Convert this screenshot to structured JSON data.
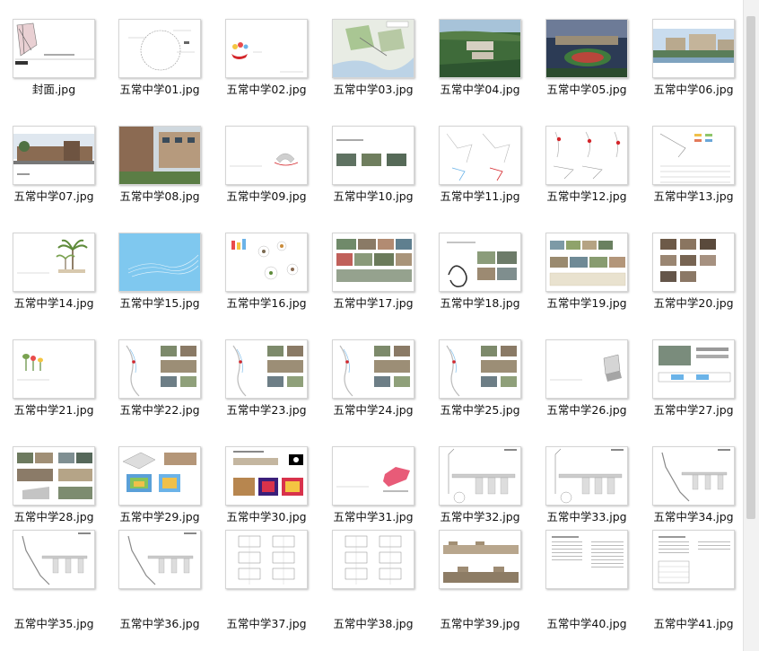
{
  "files": [
    {
      "name": "封面.jpg",
      "kind": "cover"
    },
    {
      "name": "五常中学01.jpg",
      "kind": "sketch-circle"
    },
    {
      "name": "五常中学02.jpg",
      "kind": "sketch-red"
    },
    {
      "name": "五常中学03.jpg",
      "kind": "map"
    },
    {
      "name": "五常中学04.jpg",
      "kind": "aerial-green"
    },
    {
      "name": "五常中学05.jpg",
      "kind": "aerial-dusk"
    },
    {
      "name": "五常中学06.jpg",
      "kind": "render-lake"
    },
    {
      "name": "五常中学07.jpg",
      "kind": "render-building"
    },
    {
      "name": "五常中学08.jpg",
      "kind": "render-street"
    },
    {
      "name": "五常中学09.jpg",
      "kind": "diagram-center"
    },
    {
      "name": "五常中学10.jpg",
      "kind": "photo-row"
    },
    {
      "name": "五常中学11.jpg",
      "kind": "diagram-pair"
    },
    {
      "name": "五常中学12.jpg",
      "kind": "diagram-three"
    },
    {
      "name": "五常中学13.jpg",
      "kind": "table-chart"
    },
    {
      "name": "五常中学14.jpg",
      "kind": "palm"
    },
    {
      "name": "五常中学15.jpg",
      "kind": "blue"
    },
    {
      "name": "五常中学16.jpg",
      "kind": "bubbles"
    },
    {
      "name": "五常中学17.jpg",
      "kind": "photo-grid"
    },
    {
      "name": "五常中学18.jpg",
      "kind": "dragon"
    },
    {
      "name": "五常中学19.jpg",
      "kind": "photo-board"
    },
    {
      "name": "五常中学20.jpg",
      "kind": "photo-stack"
    },
    {
      "name": "五常中学21.jpg",
      "kind": "plants"
    },
    {
      "name": "五常中学22.jpg",
      "kind": "plan-photos"
    },
    {
      "name": "五常中学23.jpg",
      "kind": "plan-photos"
    },
    {
      "name": "五常中学24.jpg",
      "kind": "plan-photos"
    },
    {
      "name": "五常中学25.jpg",
      "kind": "plan-photos"
    },
    {
      "name": "五常中学26.jpg",
      "kind": "object"
    },
    {
      "name": "五常中学27.jpg",
      "kind": "tech"
    },
    {
      "name": "五常中学28.jpg",
      "kind": "photo-grid2"
    },
    {
      "name": "五常中学29.jpg",
      "kind": "heatmap"
    },
    {
      "name": "五常中学30.jpg",
      "kind": "heatmap2"
    },
    {
      "name": "五常中学31.jpg",
      "kind": "pink"
    },
    {
      "name": "五常中学32.jpg",
      "kind": "plan-tall"
    },
    {
      "name": "五常中学33.jpg",
      "kind": "plan-tall"
    },
    {
      "name": "五常中学34.jpg",
      "kind": "plan-tall2"
    },
    {
      "name": "五常中学35.jpg",
      "kind": "plan-tall2"
    },
    {
      "name": "五常中学36.jpg",
      "kind": "plan-tall2"
    },
    {
      "name": "五常中学37.jpg",
      "kind": "floor-grid"
    },
    {
      "name": "五常中学38.jpg",
      "kind": "floor-grid"
    },
    {
      "name": "五常中学39.jpg",
      "kind": "elevation"
    },
    {
      "name": "五常中学40.jpg",
      "kind": "text-doc"
    },
    {
      "name": "五常中学41.jpg",
      "kind": "text-doc2"
    }
  ],
  "colors": {
    "label": "#111111",
    "border": "#d5d5d5",
    "accent_red": "#d4262b",
    "sky_blue": "#7fc8ef",
    "pink": "#e85b78"
  }
}
